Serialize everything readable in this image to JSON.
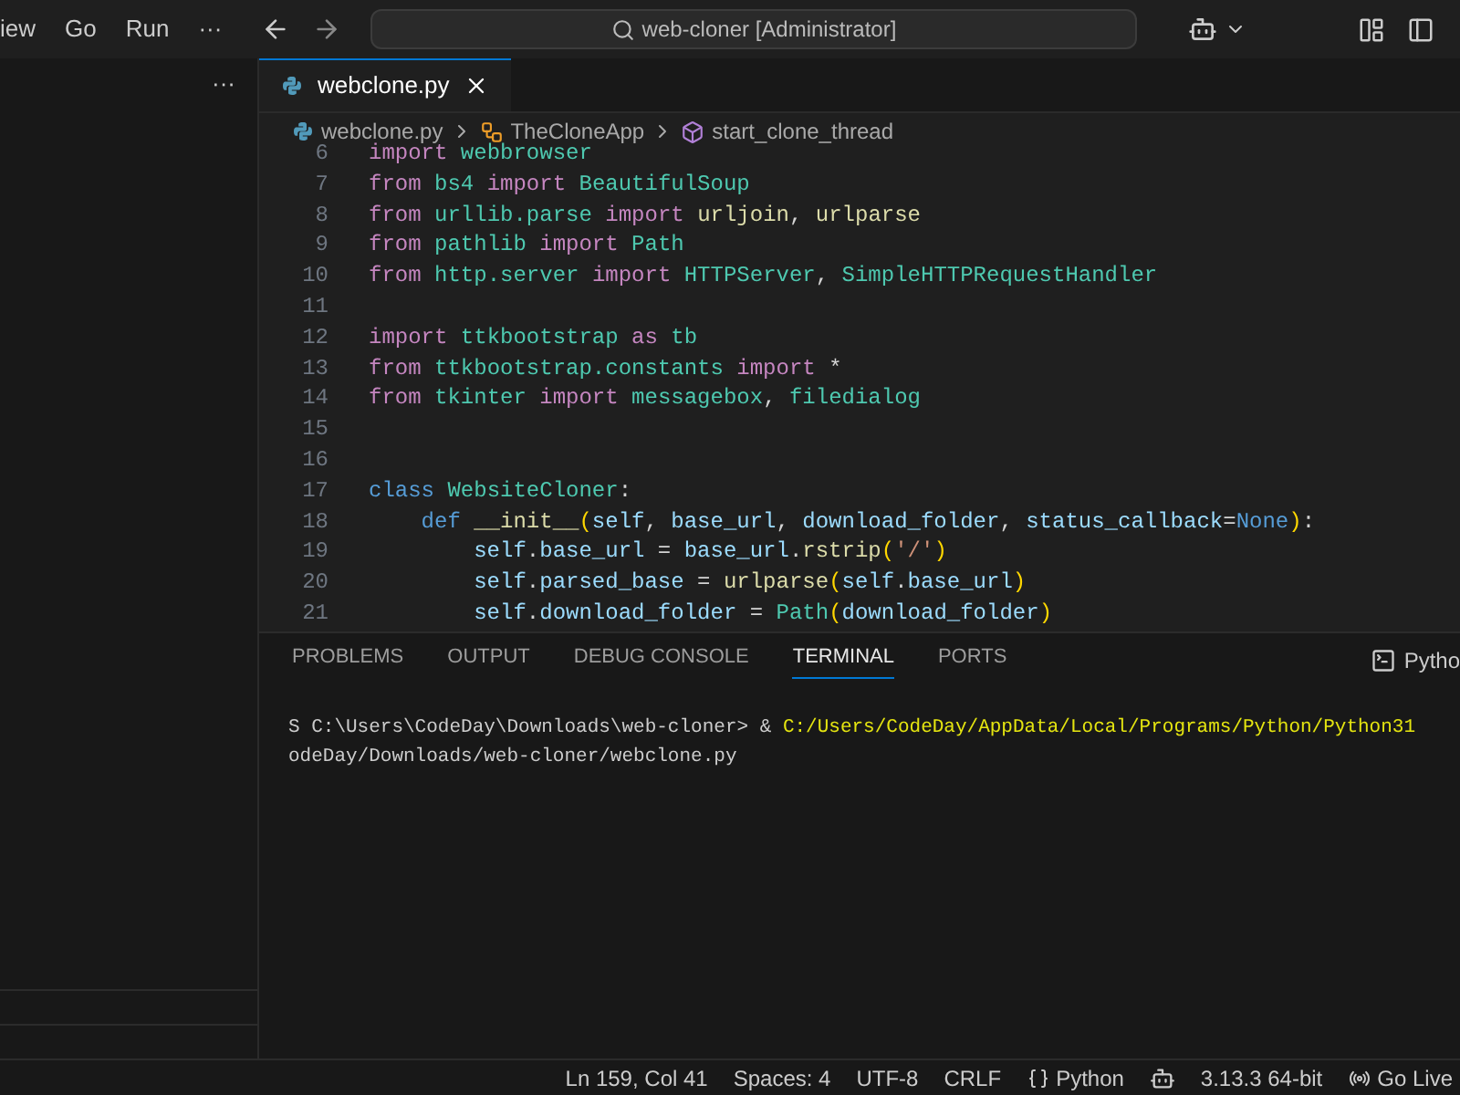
{
  "menu": [
    "iew",
    "Go",
    "Run",
    "···"
  ],
  "command_center": {
    "text": "web-cloner [Administrator]"
  },
  "sidebar": {
    "more": "···"
  },
  "editor_tabs": [
    {
      "label": "webclone.py",
      "selected": true
    }
  ],
  "breadcrumbs": [
    {
      "label": "webclone.py",
      "kind": "file"
    },
    {
      "label": "TheCloneApp",
      "kind": "class"
    },
    {
      "label": "start_clone_thread",
      "kind": "method"
    }
  ],
  "code_lines": [
    {
      "number": "6",
      "tokens": [
        {
          "text": "import ",
          "kind": "keyword"
        },
        {
          "text": "webbrowser",
          "kind": "type"
        }
      ]
    },
    {
      "number": "7",
      "tokens": [
        {
          "text": "from ",
          "kind": "keyword"
        },
        {
          "text": "bs4 ",
          "kind": "type"
        },
        {
          "text": "import ",
          "kind": "keyword"
        },
        {
          "text": "BeautifulSoup",
          "kind": "type"
        }
      ]
    },
    {
      "number": "8",
      "tokens": [
        {
          "text": "from ",
          "kind": "keyword"
        },
        {
          "text": "urllib.parse ",
          "kind": "type"
        },
        {
          "text": "import ",
          "kind": "keyword"
        },
        {
          "text": "urljoin",
          "kind": "function"
        },
        {
          "text": ", ",
          "kind": "plain"
        },
        {
          "text": "urlparse",
          "kind": "function"
        }
      ]
    },
    {
      "number": "9",
      "tokens": [
        {
          "text": "from ",
          "kind": "keyword"
        },
        {
          "text": "pathlib ",
          "kind": "type"
        },
        {
          "text": "import ",
          "kind": "keyword"
        },
        {
          "text": "Path",
          "kind": "type"
        }
      ]
    },
    {
      "number": "10",
      "tokens": [
        {
          "text": "from ",
          "kind": "keyword"
        },
        {
          "text": "http.server ",
          "kind": "type"
        },
        {
          "text": "import ",
          "kind": "keyword"
        },
        {
          "text": "HTTPServer",
          "kind": "type"
        },
        {
          "text": ", ",
          "kind": "plain"
        },
        {
          "text": "SimpleHTTPRequestHandler",
          "kind": "type"
        }
      ]
    },
    {
      "number": "11"
    },
    {
      "number": "12",
      "tokens": [
        {
          "text": "import ",
          "kind": "keyword"
        },
        {
          "text": "ttkbootstrap ",
          "kind": "type"
        },
        {
          "text": "as ",
          "kind": "keyword"
        },
        {
          "text": "tb",
          "kind": "type"
        }
      ]
    },
    {
      "number": "13",
      "tokens": [
        {
          "text": "from ",
          "kind": "keyword"
        },
        {
          "text": "ttkbootstrap.constants ",
          "kind": "type"
        },
        {
          "text": "import ",
          "kind": "keyword"
        },
        {
          "text": "*",
          "kind": "plain"
        }
      ]
    },
    {
      "number": "14",
      "tokens": [
        {
          "text": "from ",
          "kind": "keyword"
        },
        {
          "text": "tkinter ",
          "kind": "type"
        },
        {
          "text": "import ",
          "kind": "keyword"
        },
        {
          "text": "messagebox",
          "kind": "type"
        },
        {
          "text": ", ",
          "kind": "plain"
        },
        {
          "text": "filedialog",
          "kind": "type"
        }
      ]
    },
    {
      "number": "15"
    },
    {
      "number": "16"
    },
    {
      "number": "17",
      "tokens": [
        {
          "text": "class ",
          "kind": "storage"
        },
        {
          "text": "WebsiteCloner",
          "kind": "type"
        },
        {
          "text": ":",
          "kind": "plain"
        }
      ]
    },
    {
      "number": "18",
      "tokens": [
        {
          "text": "    def ",
          "kind": "storage"
        },
        {
          "text": "__init__",
          "kind": "function"
        },
        {
          "text": "(",
          "kind": "bracket"
        },
        {
          "text": "self",
          "kind": "variable"
        },
        {
          "text": ", ",
          "kind": "plain"
        },
        {
          "text": "base_url",
          "kind": "variable"
        },
        {
          "text": ", ",
          "kind": "plain"
        },
        {
          "text": "download_folder",
          "kind": "variable"
        },
        {
          "text": ", ",
          "kind": "plain"
        },
        {
          "text": "status_callback",
          "kind": "variable"
        },
        {
          "text": "=",
          "kind": "plain"
        },
        {
          "text": "None",
          "kind": "storage"
        },
        {
          "text": ")",
          "kind": "bracket"
        },
        {
          "text": ":",
          "kind": "plain"
        }
      ]
    },
    {
      "number": "19",
      "tokens": [
        {
          "text": "        self",
          "kind": "variable"
        },
        {
          "text": ".",
          "kind": "plain"
        },
        {
          "text": "base_url",
          "kind": "variable"
        },
        {
          "text": " = ",
          "kind": "plain"
        },
        {
          "text": "base_url",
          "kind": "variable"
        },
        {
          "text": ".",
          "kind": "plain"
        },
        {
          "text": "rstrip",
          "kind": "function"
        },
        {
          "text": "(",
          "kind": "bracket"
        },
        {
          "text": "'/'",
          "kind": "string"
        },
        {
          "text": ")",
          "kind": "bracket"
        }
      ]
    },
    {
      "number": "20",
      "tokens": [
        {
          "text": "        self",
          "kind": "variable"
        },
        {
          "text": ".",
          "kind": "plain"
        },
        {
          "text": "parsed_base",
          "kind": "variable"
        },
        {
          "text": " = ",
          "kind": "plain"
        },
        {
          "text": "urlparse",
          "kind": "function"
        },
        {
          "text": "(",
          "kind": "bracket"
        },
        {
          "text": "self",
          "kind": "variable"
        },
        {
          "text": ".",
          "kind": "plain"
        },
        {
          "text": "base_url",
          "kind": "variable"
        },
        {
          "text": ")",
          "kind": "bracket"
        }
      ]
    },
    {
      "number": "21",
      "tokens": [
        {
          "text": "        self",
          "kind": "variable"
        },
        {
          "text": ".",
          "kind": "plain"
        },
        {
          "text": "download_folder",
          "kind": "variable"
        },
        {
          "text": " = ",
          "kind": "plain"
        },
        {
          "text": "Path",
          "kind": "type"
        },
        {
          "text": "(",
          "kind": "bracket"
        },
        {
          "text": "download_folder",
          "kind": "variable"
        },
        {
          "text": ")",
          "kind": "bracket"
        }
      ]
    }
  ],
  "panel_tabs": [
    {
      "label": "PROBLEMS",
      "selected": false
    },
    {
      "label": "OUTPUT",
      "selected": false
    },
    {
      "label": "DEBUG CONSOLE",
      "selected": false
    },
    {
      "label": "TERMINAL",
      "selected": true
    },
    {
      "label": "PORTS",
      "selected": false
    }
  ],
  "terminal_profile": "Pytho",
  "terminal_lines": [
    {
      "segments": [
        {
          "text": "S C:\\Users\\CodeDay\\Downloads\\web-cloner> & ",
          "kind": "plain"
        },
        {
          "text": "C:/Users/CodeDay/AppData/Local/Programs/Python/Python31",
          "kind": "path"
        }
      ]
    },
    {
      "segments": [
        {
          "text": "odeDay/Downloads/web-cloner/webclone.py",
          "kind": "plain"
        }
      ]
    }
  ],
  "status_bar": [
    {
      "label": "Ln 159, Col 41",
      "kind": "text"
    },
    {
      "label": "Spaces: 4",
      "kind": "text"
    },
    {
      "label": "UTF-8",
      "kind": "text"
    },
    {
      "label": "CRLF",
      "kind": "text"
    },
    {
      "label": "Python",
      "kind": "language"
    },
    {
      "kind": "copilot"
    },
    {
      "label": "3.13.3 64-bit",
      "kind": "text"
    },
    {
      "label": "Go Live",
      "kind": "live"
    }
  ]
}
